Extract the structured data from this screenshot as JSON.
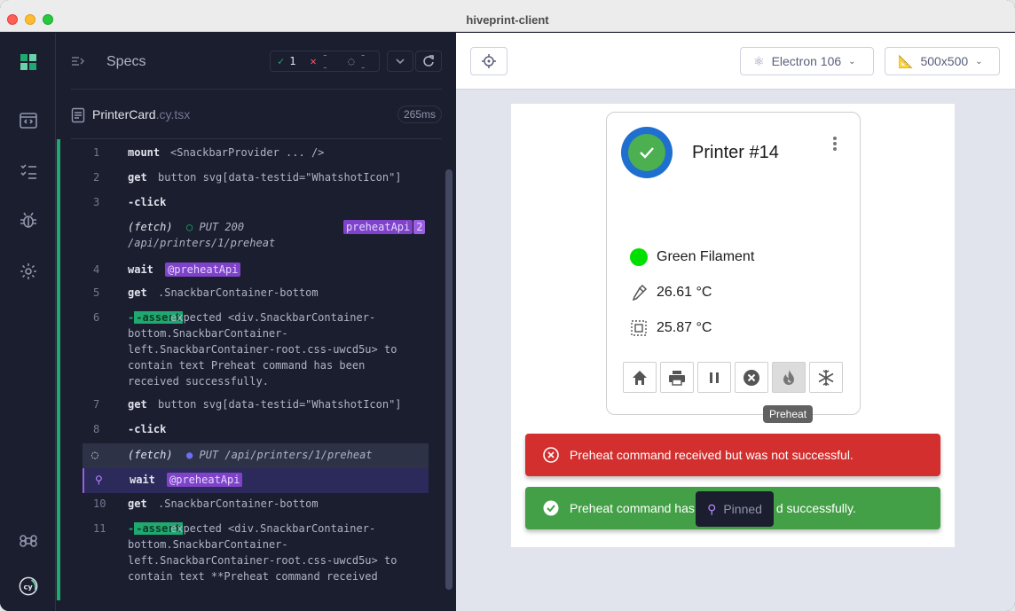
{
  "window": {
    "title": "hiveprint-client"
  },
  "specs": {
    "title": "Specs",
    "passed": "1",
    "failed": "--",
    "pending": "--"
  },
  "file": {
    "name": "PrinterCard",
    "ext": ".cy.tsx",
    "duration": "265ms"
  },
  "commands": [
    {
      "num": "1",
      "name": "mount",
      "msg": "<SnackbarProvider ... />"
    },
    {
      "num": "2",
      "name": "get",
      "msg": "button svg[data-testid=\"WhatshotIcon\"]"
    },
    {
      "num": "3",
      "name": "-click",
      "msg": ""
    },
    {
      "num": "",
      "name": "(fetch)",
      "msg": "PUT 200",
      "msg2": "/api/printers/1/preheat",
      "alias": "preheatApi",
      "alias_count": "2"
    },
    {
      "num": "4",
      "name": "wait",
      "alias": "@preheatApi"
    },
    {
      "num": "5",
      "name": "get",
      "msg": ".SnackbarContainer-bottom"
    },
    {
      "num": "6",
      "name": "-assert",
      "lines": [
        "expected <div.SnackbarContainer-",
        "bottom.SnackbarContainer-",
        "left.SnackbarContainer-root.css-uwcd5u> to",
        "contain text Preheat command has been",
        "received successfully."
      ]
    },
    {
      "num": "7",
      "name": "get",
      "msg": "button svg[data-testid=\"WhatshotIcon\"]"
    },
    {
      "num": "8",
      "name": "-click",
      "msg": ""
    },
    {
      "num": "",
      "name": "(fetch)",
      "msg": "PUT /api/printers/1/preheat"
    },
    {
      "num": "",
      "name": "wait",
      "alias": "@preheatApi"
    },
    {
      "num": "10",
      "name": "get",
      "msg": ".SnackbarContainer-bottom"
    },
    {
      "num": "11",
      "name": "-assert",
      "lines": [
        "expected <div.SnackbarContainer-",
        "bottom.SnackbarContainer-",
        "left.SnackbarContainer-root.css-uwcd5u> to",
        "contain text **Preheat command received"
      ]
    }
  ],
  "aut": {
    "browser": "Electron 106",
    "viewport": "500x500"
  },
  "printer": {
    "name": "Printer #14",
    "filament": "Green Filament",
    "nozzle_temp": "26.61 °C",
    "bed_temp": "25.87 °C",
    "tooltip": "Preheat"
  },
  "snackbars": {
    "error": "Preheat command received but was not successful.",
    "success_a": "Preheat command has",
    "success_b": "d successfully.",
    "pinned": "Pinned"
  },
  "colors": {
    "accent_green": "#1fa971",
    "alias_purple": "#7f43c9",
    "error": "#d32f2f",
    "success": "#43a047"
  }
}
